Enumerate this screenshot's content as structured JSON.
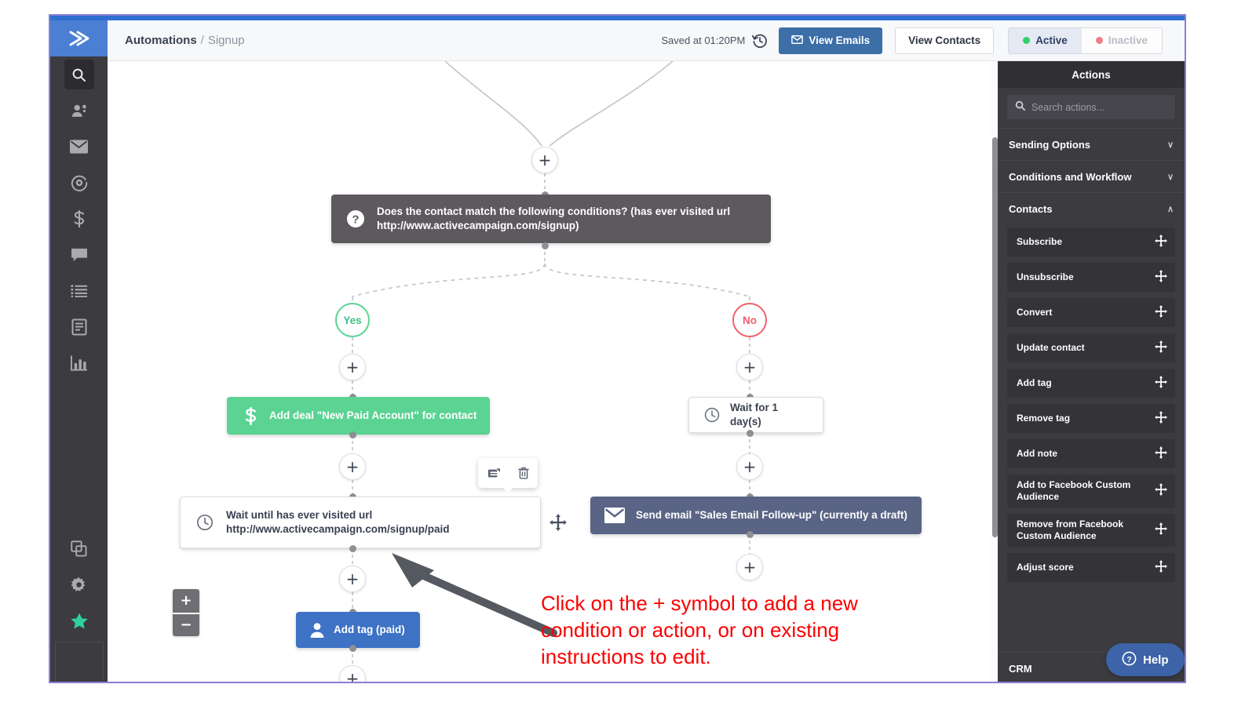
{
  "header": {
    "breadcrumb_root": "Automations",
    "breadcrumb_sep": "/",
    "breadcrumb_current": "Signup",
    "saved_text": "Saved at 01:20PM",
    "history_icon": "history-clock-icon",
    "view_emails_label": "View Emails",
    "view_emails_icon": "envelope-icon",
    "view_contacts_label": "View Contacts",
    "status_active_label": "Active",
    "status_inactive_label": "Inactive",
    "accent_blue": "#3c6fa8",
    "active_green": "#2fd16b",
    "inactive_red": "#ef7d85"
  },
  "left_rail": {
    "logo_icon": "chevron-double-right-logo",
    "items": [
      {
        "icon": "search-icon",
        "name": "search"
      },
      {
        "icon": "contacts-icon",
        "name": "contacts"
      },
      {
        "icon": "envelope-icon",
        "name": "campaigns"
      },
      {
        "icon": "target-icon",
        "name": "automations"
      },
      {
        "icon": "dollar-icon",
        "name": "deals"
      },
      {
        "icon": "chat-icon",
        "name": "conversations"
      },
      {
        "icon": "list-icon",
        "name": "lists"
      },
      {
        "icon": "page-icon",
        "name": "forms"
      },
      {
        "icon": "bar-chart-icon",
        "name": "reports"
      }
    ],
    "bottom_items": [
      {
        "icon": "copy-icon",
        "name": "apps"
      },
      {
        "icon": "gear-icon",
        "name": "settings"
      },
      {
        "icon": "star-icon",
        "name": "favorites",
        "color": "#2fd19b"
      }
    ]
  },
  "canvas": {
    "top_plus_label": "+",
    "condition": {
      "icon": "question-mark-icon",
      "text": "Does the contact match the following conditions? (has ever visited url http://www.activecampaign.com/signup)",
      "color": "#5e595e"
    },
    "branch_yes": "Yes",
    "branch_no": "No",
    "nodes": {
      "add_deal": {
        "icon": "dollar-icon",
        "text": "Add deal \"New Paid Account\" for contact",
        "color": "#5ad393"
      },
      "wait_until": {
        "icon": "clock-icon",
        "text": "Wait until has ever visited url http://www.activecampaign.com/signup/paid",
        "color": "#ffffff"
      },
      "add_tag": {
        "icon": "person-icon",
        "text": "Add tag (paid)",
        "color": "#3d72c4"
      },
      "wait_1_day": {
        "icon": "clock-icon",
        "text": "Wait for 1 day(s)",
        "color": "#ffffff"
      },
      "send_email": {
        "icon": "envelope-icon",
        "text": "Send email \"Sales Email Follow-up\" (currently a draft)",
        "color": "#5a6485"
      }
    },
    "node_toolbar": {
      "edit_icon": "edit-note-icon",
      "delete_icon": "trash-icon"
    },
    "drag_handle_icon": "move-arrows-icon",
    "zoom_in_label": "+",
    "zoom_out_label": "−",
    "annotation": "Click on the + symbol to add a new condition or action, or on existing instructions to edit.",
    "annotation_color": "#fb0000"
  },
  "actions_panel": {
    "title": "Actions",
    "search_placeholder": "Search actions...",
    "search_icon": "search-icon",
    "groups": [
      {
        "label": "Sending Options",
        "expanded": false,
        "chevron": "∨"
      },
      {
        "label": "Conditions and Workflow",
        "expanded": false,
        "chevron": "∨"
      },
      {
        "label": "Contacts",
        "expanded": true,
        "chevron": "∧"
      }
    ],
    "contacts_items": [
      "Subscribe",
      "Unsubscribe",
      "Convert",
      "Update contact",
      "Add tag",
      "Remove tag",
      "Add note",
      "Add to Facebook Custom Audience",
      "Remove from Facebook Custom Audience",
      "Adjust score"
    ],
    "bottom_group": {
      "label": "CRM",
      "chevron": "∨"
    },
    "drag_icon": "move-arrows-icon"
  },
  "help_button": {
    "label": "Help",
    "icon": "question-circle-icon"
  }
}
